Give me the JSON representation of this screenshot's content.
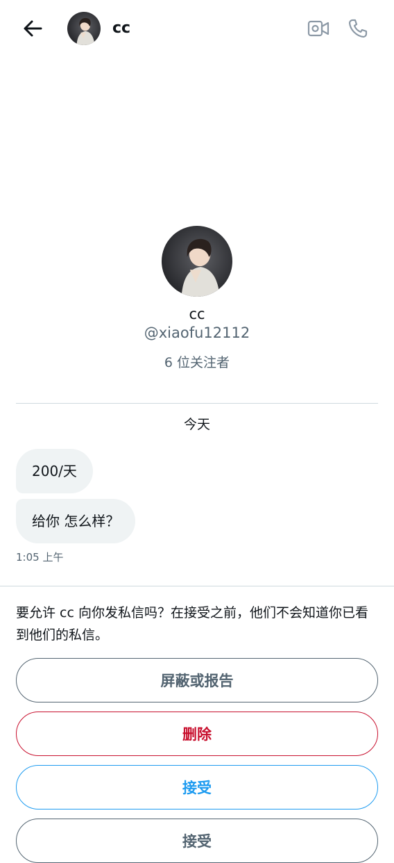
{
  "header": {
    "name": "cc",
    "icons": {
      "back": "arrow-left-icon",
      "video": "video-camera-icon",
      "call": "phone-icon"
    }
  },
  "profile": {
    "name": "cc",
    "handle": "@xiaofu12112",
    "followers": "6 位关注者"
  },
  "conversation": {
    "day_label": "今天",
    "messages": [
      {
        "text": "200/天"
      },
      {
        "text": "给你 怎么样？"
      }
    ],
    "time": "1:05 上午"
  },
  "request": {
    "prompt": "要允许 cc 向你发私信吗？在接受之前，他们不会知道你已看到他们的私信。",
    "buttons": {
      "block_report": "屏蔽或报告",
      "delete": "删除",
      "accept": "接受",
      "partial": "接受"
    }
  },
  "colors": {
    "primary_text": "#0f1419",
    "secondary_text": "#536471",
    "danger": "#c8102e",
    "accent": "#1d9bf0",
    "bubble_bg": "#eff3f4",
    "divider": "#cfd9de"
  }
}
